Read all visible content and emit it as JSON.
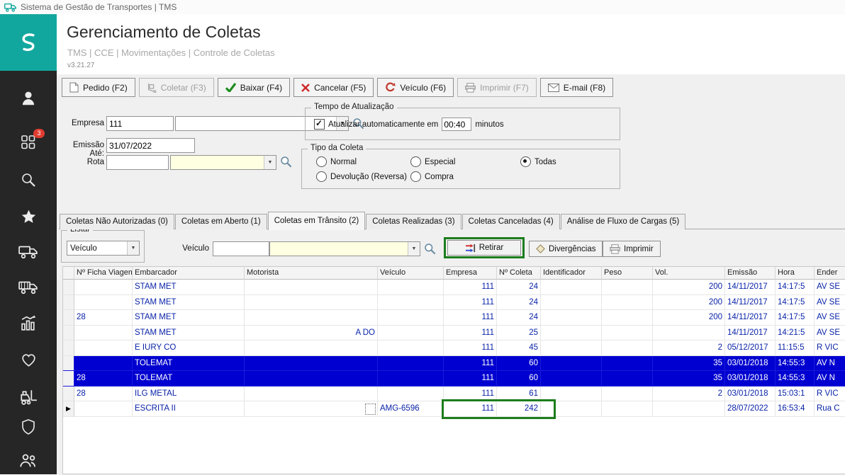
{
  "window": {
    "title": "Sistema de Gestão de Transportes | TMS"
  },
  "header": {
    "title": "Gerenciamento de Coletas",
    "breadcrumb": "TMS | CCE | Movimentações | Controle de Coletas",
    "version": "v3.21.27"
  },
  "sidebar": {
    "items": [
      {
        "icon": "user-icon"
      },
      {
        "icon": "apps-grid-icon",
        "badge": "3"
      },
      {
        "icon": "search-icon"
      },
      {
        "icon": "star-icon"
      },
      {
        "icon": "truck-icon"
      },
      {
        "icon": "truck-alt-icon"
      },
      {
        "icon": "chart-icon"
      },
      {
        "icon": "heart-icon"
      },
      {
        "icon": "forklift-icon"
      },
      {
        "icon": "shield-icon"
      },
      {
        "icon": "users-icon"
      }
    ]
  },
  "toolbar": {
    "buttons": [
      {
        "label": "Pedido (F2)",
        "icon": "document-icon",
        "disabled": false
      },
      {
        "label": "Coletar (F3)",
        "icon": "collect-icon",
        "disabled": true
      },
      {
        "label": "Baixar (F4)",
        "icon": "check-icon",
        "disabled": false
      },
      {
        "label": "Cancelar (F5)",
        "icon": "cancel-icon",
        "disabled": false
      },
      {
        "label": "Veículo (F6)",
        "icon": "vehicle-icon",
        "disabled": false
      },
      {
        "label": "Imprimir (F7)",
        "icon": "printer-icon",
        "disabled": true
      },
      {
        "label": "E-mail (F8)",
        "icon": "email-icon",
        "disabled": false
      }
    ]
  },
  "filters": {
    "empresa_label": "Empresa",
    "empresa_value": "111",
    "empresa_combo_value": "",
    "emissao_label": "Emissão Até:",
    "emissao_value": "31/07/2022",
    "rota_label": "Rota",
    "rota_value": "",
    "rota_combo_value": "",
    "tempo_group_title": "Tempo de Atualização",
    "auto_update_label": "Atualizar automaticamente em",
    "auto_update_checked": true,
    "auto_update_value": "00:40",
    "auto_update_suffix": "minutos",
    "tipo_group_title": "Tipo da Coleta",
    "tipo_options": [
      {
        "label": "Normal",
        "selected": false
      },
      {
        "label": "Especial",
        "selected": false
      },
      {
        "label": "Todas",
        "selected": true
      },
      {
        "label": "Devolução (Reversa)",
        "selected": false
      },
      {
        "label": "Compra",
        "selected": false
      }
    ]
  },
  "tabs": {
    "items": [
      {
        "label": "Coletas Não Autorizadas (0)",
        "active": false
      },
      {
        "label": "Coletas em Aberto (1)",
        "active": false
      },
      {
        "label": "Coletas em Trânsito (2)",
        "active": true
      },
      {
        "label": "Coletas Realizadas (3)",
        "active": false
      },
      {
        "label": "Coletas Canceladas (4)",
        "active": false
      },
      {
        "label": "Análise de Fluxo de Cargas (5)",
        "active": false
      }
    ]
  },
  "list_panel": {
    "listar_group_title": "Listar",
    "listar_combo_value": "Veículo",
    "veiculo_label": "Veículo",
    "veiculo_input_value": "",
    "veiculo_combo_value": "",
    "retirar_label": "Retirar",
    "divergencias_label": "Divergências",
    "imprimir_label": "Imprimir"
  },
  "table": {
    "current_marker": "▶",
    "columns": [
      "Nº Ficha Viagem",
      "Embarcador",
      "Motorista",
      "Veículo",
      "Empresa",
      "Nº Coleta",
      "Identificador",
      "Peso",
      "Vol.",
      "Emissão",
      "Hora",
      "Ender"
    ],
    "rows": [
      {
        "ficha": "",
        "embarcador": "STAM MET",
        "motorista": "",
        "veiculo": "",
        "empresa": "111",
        "coleta": "24",
        "identificador": "",
        "peso": "",
        "vol": "200",
        "emissao": "14/11/2017",
        "hora": "14:17:5",
        "endereco": "AV SE",
        "selected": false,
        "current": false
      },
      {
        "ficha": "",
        "embarcador": "STAM MET",
        "motorista": "",
        "veiculo": "",
        "empresa": "111",
        "coleta": "24",
        "identificador": "",
        "peso": "",
        "vol": "200",
        "emissao": "14/11/2017",
        "hora": "14:17:5",
        "endereco": "AV SE",
        "selected": false,
        "current": false
      },
      {
        "ficha": "28",
        "embarcador": "STAM MET",
        "motorista": "",
        "veiculo": "",
        "empresa": "111",
        "coleta": "24",
        "identificador": "",
        "peso": "",
        "vol": "200",
        "emissao": "14/11/2017",
        "hora": "14:17:5",
        "endereco": "AV SE",
        "selected": false,
        "current": false
      },
      {
        "ficha": "",
        "embarcador": "STAM MET",
        "motorista": "A DO",
        "m_align": "r",
        "veiculo": "",
        "empresa": "111",
        "coleta": "25",
        "identificador": "",
        "peso": "",
        "vol": "",
        "emissao": "14/11/2017",
        "hora": "14:21:5",
        "endereco": "AV SE",
        "selected": false,
        "current": false
      },
      {
        "ficha": "",
        "embarcador": "E IURY CO",
        "motorista": "",
        "veiculo": "",
        "empresa": "111",
        "coleta": "45",
        "identificador": "",
        "peso": "",
        "vol": "2",
        "emissao": "05/12/2017",
        "hora": "11:15:5",
        "endereco": "R VIC",
        "selected": false,
        "current": false
      },
      {
        "ficha": "",
        "embarcador": "TOLEMAT",
        "motorista": "",
        "veiculo": "",
        "empresa": "111",
        "coleta": "60",
        "identificador": "",
        "peso": "",
        "vol": "35",
        "emissao": "03/01/2018",
        "hora": "14:55:3",
        "endereco": "AV N",
        "selected": true,
        "current": false
      },
      {
        "ficha": "28",
        "embarcador": "TOLEMAT",
        "motorista": "",
        "veiculo": "",
        "empresa": "111",
        "coleta": "60",
        "identificador": "",
        "peso": "",
        "vol": "35",
        "emissao": "03/01/2018",
        "hora": "14:55:3",
        "endereco": "AV N",
        "selected": true,
        "current": false
      },
      {
        "ficha": "28",
        "embarcador": "ILG METAL",
        "motorista": "",
        "veiculo": "",
        "empresa": "111",
        "coleta": "61",
        "identificador": "",
        "peso": "",
        "vol": "2",
        "emissao": "03/01/2018",
        "hora": "15:03:1",
        "endereco": "R VIC",
        "selected": false,
        "current": false
      },
      {
        "ficha": "",
        "embarcador": "ESCRITA II",
        "motorista": "",
        "veiculo": "AMG-6596",
        "empresa": "111",
        "coleta": "242",
        "identificador": "",
        "peso": "",
        "vol": "",
        "emissao": "28/07/2022",
        "hora": "16:53:4",
        "endereco": "Rua C",
        "selected": false,
        "current": true
      }
    ]
  },
  "colors": {
    "accent_teal": "#12a79e",
    "selection_blue": "#0000d0",
    "data_navy": "#0a23a8",
    "annotation_green": "#1d7d1d",
    "badge_red": "#e03c31"
  }
}
